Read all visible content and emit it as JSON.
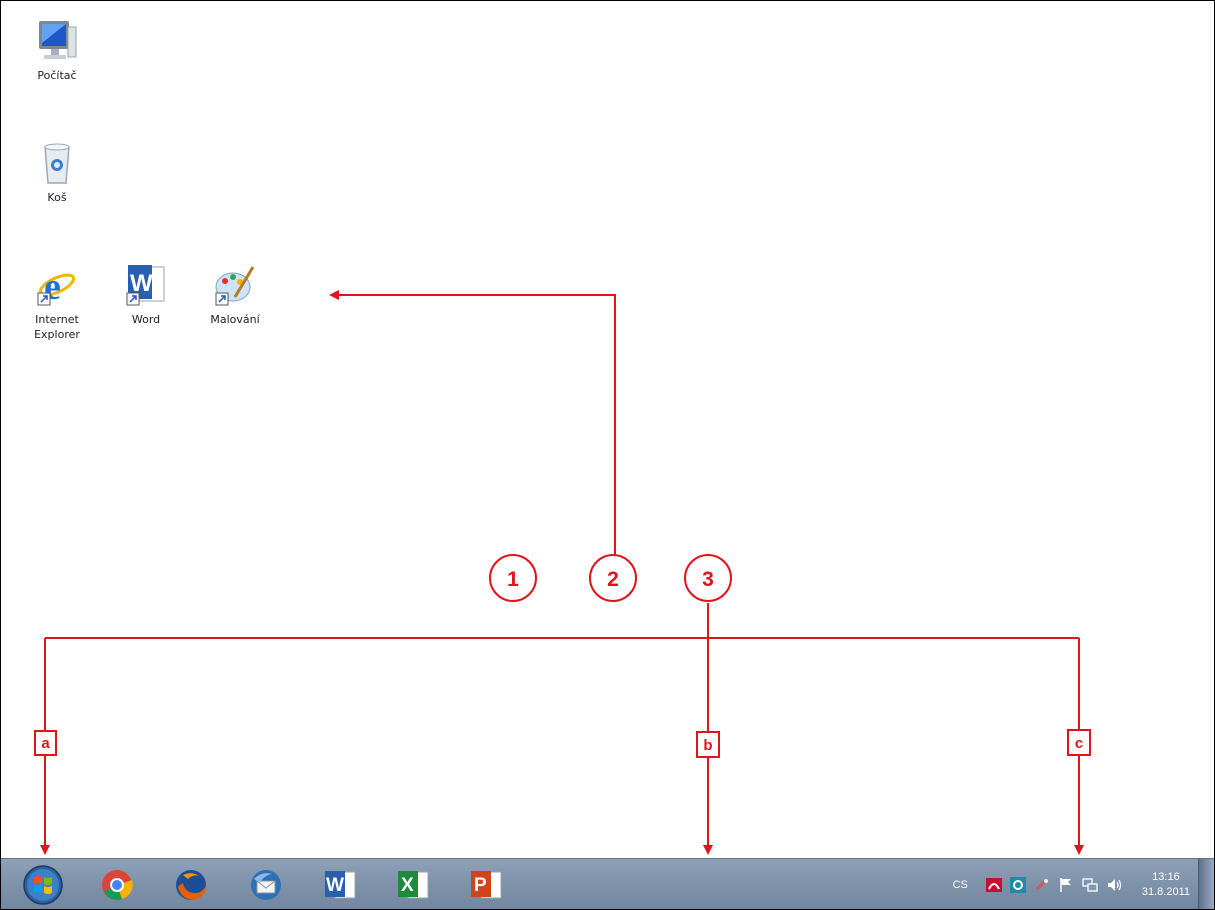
{
  "desktop": {
    "icons": [
      {
        "id": "computer",
        "label": "Počítač",
        "icon": "computer-icon"
      },
      {
        "id": "recycle",
        "label": "Koš",
        "icon": "recycle-bin-icon"
      },
      {
        "id": "ie",
        "label": "Internet Explorer",
        "icon": "internet-explorer-icon"
      },
      {
        "id": "word",
        "label": "Word",
        "icon": "word-icon"
      },
      {
        "id": "paint",
        "label": "Malování",
        "icon": "paint-icon"
      }
    ]
  },
  "callouts": {
    "numbers": [
      "1",
      "2",
      "3"
    ],
    "letters": [
      "a",
      "b",
      "c"
    ],
    "color": "#e1141b"
  },
  "taskbar": {
    "pinned": [
      {
        "id": "start",
        "icon": "windows-start-icon"
      },
      {
        "id": "chrome",
        "icon": "chrome-icon"
      },
      {
        "id": "firefox",
        "icon": "firefox-icon"
      },
      {
        "id": "thunderbird",
        "icon": "thunderbird-icon"
      },
      {
        "id": "word",
        "icon": "word-icon"
      },
      {
        "id": "excel",
        "icon": "excel-icon"
      },
      {
        "id": "powerpoint",
        "icon": "powerpoint-icon"
      }
    ],
    "tray": {
      "language": "CS",
      "time": "13:16",
      "date": "31.8.2011",
      "icons": [
        "acrobat-icon",
        "sync-icon",
        "bluetooth-icon",
        "flag-icon",
        "network-icon",
        "volume-icon"
      ]
    },
    "colors": {
      "bar": "#8197b0"
    }
  }
}
